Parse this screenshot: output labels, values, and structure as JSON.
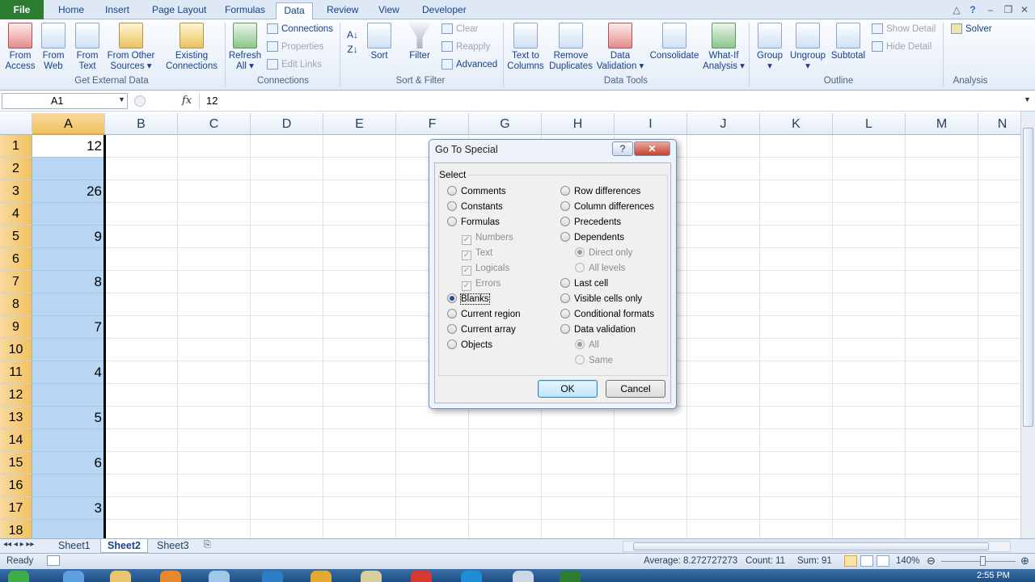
{
  "tabs": [
    "File",
    "Home",
    "Insert",
    "Page Layout",
    "Formulas",
    "Data",
    "Review",
    "View",
    "Developer"
  ],
  "active_tab": "Data",
  "ribbon": {
    "get_external": {
      "group": "Get External Data",
      "from_access": [
        "From",
        "Access"
      ],
      "from_web": [
        "From",
        "Web"
      ],
      "from_text": [
        "From",
        "Text"
      ],
      "from_other": [
        "From Other",
        "Sources ▾"
      ],
      "existing": [
        "Existing",
        "Connections"
      ]
    },
    "connections": {
      "group": "Connections",
      "refresh": [
        "Refresh",
        "All ▾"
      ],
      "connections": "Connections",
      "properties": "Properties",
      "edit_links": "Edit Links"
    },
    "sort_filter": {
      "group": "Sort & Filter",
      "sort": "Sort",
      "filter": "Filter",
      "clear": "Clear",
      "reapply": "Reapply",
      "advanced": "Advanced"
    },
    "data_tools": {
      "group": "Data Tools",
      "text_to_columns": [
        "Text to",
        "Columns"
      ],
      "remove_duplicates": [
        "Remove",
        "Duplicates"
      ],
      "data_validation": [
        "Data",
        "Validation ▾"
      ],
      "consolidate": "Consolidate",
      "what_if": [
        "What-If",
        "Analysis ▾"
      ]
    },
    "outline": {
      "group": "Outline",
      "group_btn": [
        "Group",
        "▾"
      ],
      "ungroup": [
        "Ungroup",
        "▾"
      ],
      "subtotal": "Subtotal",
      "show_detail": "Show Detail",
      "hide_detail": "Hide Detail"
    },
    "analysis": {
      "group": "Analysis",
      "solver": "Solver"
    }
  },
  "formula_bar": {
    "name_box": "A1",
    "fx": "fx",
    "value": "12"
  },
  "columns": [
    "A",
    "B",
    "C",
    "D",
    "E",
    "F",
    "G",
    "H",
    "I",
    "J",
    "K",
    "L",
    "M",
    "N"
  ],
  "rows": [
    "1",
    "2",
    "3",
    "4",
    "5",
    "6",
    "7",
    "8",
    "9",
    "10",
    "11",
    "12",
    "13",
    "14",
    "15",
    "16",
    "17",
    "18"
  ],
  "column_a_values": [
    "12",
    "",
    "26",
    "",
    "9",
    "",
    "8",
    "",
    "7",
    "",
    "4",
    "",
    "5",
    "",
    "6",
    "",
    "3",
    ""
  ],
  "sheets": [
    "Sheet1",
    "Sheet2",
    "Sheet3"
  ],
  "active_sheet": "Sheet2",
  "status": {
    "ready": "Ready",
    "average": "Average: 8.272727273",
    "count": "Count: 11",
    "sum": "Sum: 91",
    "zoom": "140%"
  },
  "taskbar_time": "2:55 PM",
  "dialog": {
    "title": "Go To Special",
    "help": "?",
    "close": "✕",
    "group_label": "Select",
    "left_options": [
      {
        "label": "Comments",
        "kind": "radio",
        "checked": false,
        "disabled": false
      },
      {
        "label": "Constants",
        "kind": "radio",
        "checked": false,
        "disabled": false
      },
      {
        "label": "Formulas",
        "kind": "radio",
        "checked": false,
        "disabled": false
      },
      {
        "label": "Numbers",
        "kind": "check",
        "checked": true,
        "disabled": true
      },
      {
        "label": "Text",
        "kind": "check",
        "checked": true,
        "disabled": true
      },
      {
        "label": "Logicals",
        "kind": "check",
        "checked": true,
        "disabled": true
      },
      {
        "label": "Errors",
        "kind": "check",
        "checked": true,
        "disabled": true
      },
      {
        "label": "Blanks",
        "kind": "radio",
        "checked": true,
        "disabled": false
      },
      {
        "label": "Current region",
        "kind": "radio",
        "checked": false,
        "disabled": false
      },
      {
        "label": "Current array",
        "kind": "radio",
        "checked": false,
        "disabled": false
      },
      {
        "label": "Objects",
        "kind": "radio",
        "checked": false,
        "disabled": false
      }
    ],
    "right_options": [
      {
        "label": "Row differences",
        "kind": "radio",
        "checked": false,
        "disabled": false
      },
      {
        "label": "Column differences",
        "kind": "radio",
        "checked": false,
        "disabled": false
      },
      {
        "label": "Precedents",
        "kind": "radio",
        "checked": false,
        "disabled": false
      },
      {
        "label": "Dependents",
        "kind": "radio",
        "checked": false,
        "disabled": false
      },
      {
        "label": "Direct only",
        "kind": "radio",
        "checked": true,
        "disabled": true
      },
      {
        "label": "All levels",
        "kind": "radio",
        "checked": false,
        "disabled": true
      },
      {
        "label": "Last cell",
        "kind": "radio",
        "checked": false,
        "disabled": false
      },
      {
        "label": "Visible cells only",
        "kind": "radio",
        "checked": false,
        "disabled": false
      },
      {
        "label": "Conditional formats",
        "kind": "radio",
        "checked": false,
        "disabled": false
      },
      {
        "label": "Data validation",
        "kind": "radio",
        "checked": false,
        "disabled": false
      },
      {
        "label": "All",
        "kind": "radio",
        "checked": true,
        "disabled": true
      },
      {
        "label": "Same",
        "kind": "radio",
        "checked": false,
        "disabled": true
      }
    ],
    "ok": "OK",
    "cancel": "Cancel"
  }
}
